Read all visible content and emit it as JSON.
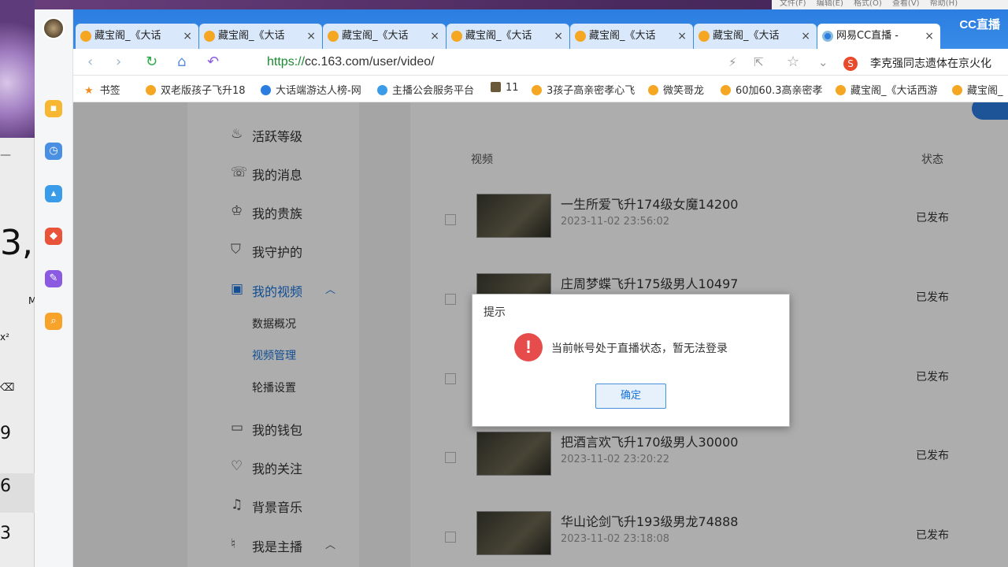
{
  "native_menu": [
    "文件(F)",
    "编辑(E)",
    "格式(O)",
    "查看(V)",
    "帮助(H)"
  ],
  "calculator": {
    "display_partial": "3,",
    "memory_label": "M",
    "power_label": "x²",
    "clear_label": "⌫",
    "keys": [
      "9",
      "6",
      "3"
    ]
  },
  "browser": {
    "tabs": [
      {
        "label": "藏宝阁_《大话",
        "icon": "zangbao-icon"
      },
      {
        "label": "藏宝阁_《大话",
        "icon": "zangbao-icon"
      },
      {
        "label": "藏宝阁_《大话",
        "icon": "zangbao-icon"
      },
      {
        "label": "藏宝阁_《大话",
        "icon": "zangbao-icon"
      },
      {
        "label": "藏宝阁_《大话",
        "icon": "zangbao-icon"
      },
      {
        "label": "藏宝阁_《大话",
        "icon": "zangbao-icon"
      },
      {
        "label": "网易CC直播 -",
        "icon": "cc-icon"
      }
    ],
    "tab_close": "×",
    "brand": "CC直播",
    "url_scheme": "https://",
    "url_rest": "cc.163.com/user/video/",
    "news_headline": "李克强同志遗体在京火化",
    "bookmarks": [
      "书签",
      "双老版孩子飞升18",
      "大话端游达人榜-网",
      "主播公会服务平台",
      "11",
      "3孩子高亲密孝心飞",
      "微笑哥龙",
      "60加60.3高亲密孝",
      "藏宝阁_《大话西游",
      "藏宝阁_"
    ]
  },
  "leftnav": {
    "items": [
      {
        "label": "活跃等级",
        "icon": "flame-icon"
      },
      {
        "label": "我的消息",
        "icon": "message-icon"
      },
      {
        "label": "我的贵族",
        "icon": "crown-icon"
      },
      {
        "label": "我守护的",
        "icon": "shield-icon"
      },
      {
        "label": "我的视频",
        "icon": "video-icon"
      },
      {
        "label": "我的钱包",
        "icon": "wallet-icon"
      },
      {
        "label": "我的关注",
        "icon": "heart-icon"
      },
      {
        "label": "背景音乐",
        "icon": "music-icon"
      },
      {
        "label": "我是主播",
        "icon": "mic-icon"
      }
    ],
    "video_sub": [
      "数据概况",
      "视频管理",
      "轮播设置"
    ],
    "active_sub": "视频管理"
  },
  "table": {
    "col_video": "视频",
    "col_status": "状态",
    "rows": [
      {
        "title": "一生所爱飞升174级女魔14200",
        "date": "2023-11-02 23:56:02",
        "status": "已发布"
      },
      {
        "title": "庄周梦蝶飞升175级男人10497",
        "date": "",
        "status": "已发布"
      },
      {
        "title": "",
        "date": "",
        "status": "已发布"
      },
      {
        "title": "把酒言欢飞升170级男人30000",
        "date": "2023-11-02 23:20:22",
        "status": "已发布"
      },
      {
        "title": "华山论剑飞升193级男龙74888",
        "date": "2023-11-02 23:18:08",
        "status": "已发布"
      }
    ]
  },
  "dialog": {
    "title": "提示",
    "message": "当前帐号处于直播状态，暂无法登录",
    "ok_label": "确定",
    "icon": "warning-icon"
  },
  "colors": {
    "accent": "#2b7de0",
    "warning": "#e74c4c",
    "link_green": "#1a8b2e"
  }
}
